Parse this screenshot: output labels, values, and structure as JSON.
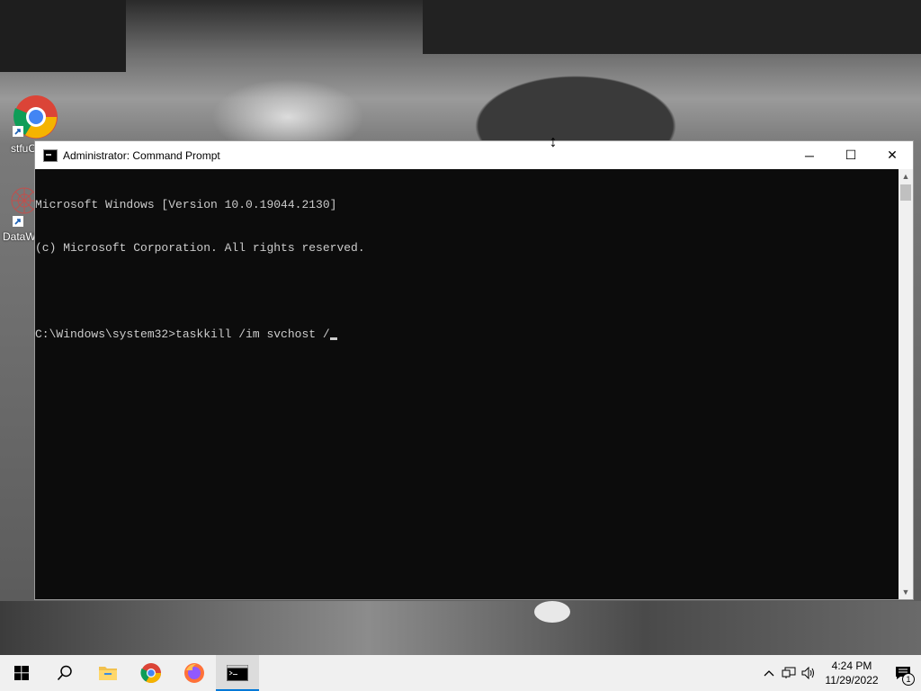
{
  "desktop": {
    "icons": [
      {
        "label": "stfuC",
        "icon": "chrome-icon"
      },
      {
        "label": "DataW",
        "icon": "datawrapper-icon"
      }
    ]
  },
  "window": {
    "title": "Administrator: Command Prompt",
    "buttons": {
      "minimize": "─",
      "maximize": "☐",
      "close": "✕"
    },
    "console_lines": [
      "Microsoft Windows [Version 10.0.19044.2130]",
      "(c) Microsoft Corporation. All rights reserved.",
      "",
      "C:\\Windows\\system32>taskkill /im svchost /"
    ]
  },
  "taskbar": {
    "items": [
      {
        "icon": "windows-start-icon",
        "active": false
      },
      {
        "icon": "search-icon",
        "active": false
      },
      {
        "icon": "file-explorer-icon",
        "active": false
      },
      {
        "icon": "chrome-icon",
        "active": false
      },
      {
        "icon": "firefox-icon",
        "active": false
      },
      {
        "icon": "command-prompt-icon",
        "active": true
      }
    ],
    "tray": {
      "chevron": "^",
      "time": "4:24 PM",
      "date": "11/29/2022",
      "notification_count": "1"
    }
  }
}
